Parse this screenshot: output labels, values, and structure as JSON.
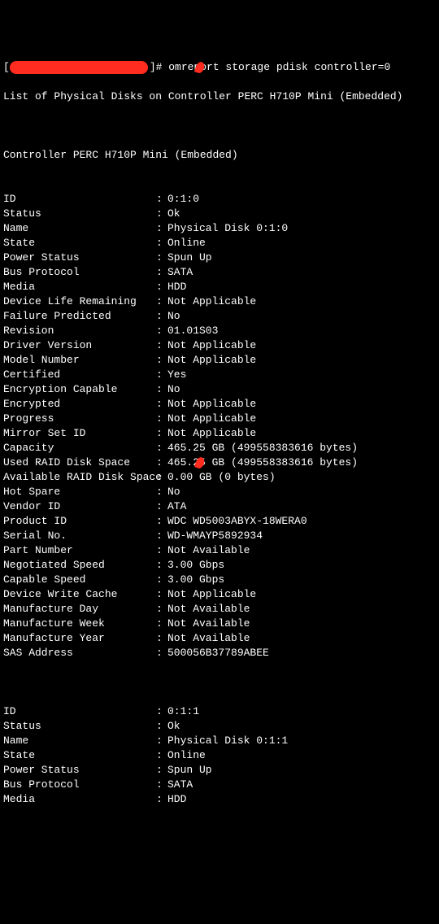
{
  "prompt": {
    "open": "[",
    "close": "]# ",
    "command": "omreport storage pdisk controller=0"
  },
  "header": "List of Physical Disks on Controller PERC H710P Mini (Embedded)",
  "controller": "Controller PERC H710P Mini (Embedded)",
  "separator": ":",
  "disk0": {
    "ID": "0:1:0",
    "Status": "Ok",
    "Name": "Physical Disk 0:1:0",
    "State": "Online",
    "Power Status": "Spun Up",
    "Bus Protocol": "SATA",
    "Media": "HDD",
    "Device Life Remaining": "Not Applicable",
    "Failure Predicted": "No",
    "Revision": "01.01S03",
    "Driver Version": "Not Applicable",
    "Model Number": "Not Applicable",
    "Certified": "Yes",
    "Encryption Capable": "No",
    "Encrypted": "Not Applicable",
    "Progress": "Not Applicable",
    "Mirror Set ID": "Not Applicable",
    "Capacity": "465.25 GB (499558383616 bytes)",
    "Used RAID Disk Space": "465.25 GB (499558383616 bytes)",
    "Available RAID Disk Space": "0.00 GB (0 bytes)",
    "Hot Spare": "No",
    "Vendor ID": "ATA",
    "Product ID": "WDC WD5003ABYX-18WERA0",
    "Serial No.": "WD-WMAYP5892934",
    "Part Number": "Not Available",
    "Negotiated Speed": "3.00 Gbps",
    "Capable Speed": "3.00 Gbps",
    "Device Write Cache": "Not Applicable",
    "Manufacture Day": "Not Available",
    "Manufacture Week": "Not Available",
    "Manufacture Year": "Not Available",
    "SAS Address": "500056B37789ABEE"
  },
  "disk0_keys": [
    "ID",
    "Status",
    "Name",
    "State",
    "Power Status",
    "Bus Protocol",
    "Media",
    "Device Life Remaining",
    "Failure Predicted",
    "Revision",
    "Driver Version",
    "Model Number",
    "Certified",
    "Encryption Capable",
    "Encrypted",
    "Progress",
    "Mirror Set ID",
    "Capacity",
    "Used RAID Disk Space",
    "Available RAID Disk Space",
    "Hot Spare",
    "Vendor ID",
    "Product ID",
    "Serial No.",
    "Part Number",
    "Negotiated Speed",
    "Capable Speed",
    "Device Write Cache",
    "Manufacture Day",
    "Manufacture Week",
    "Manufacture Year",
    "SAS Address"
  ],
  "disk1": {
    "ID": "0:1:1",
    "Status": "Ok",
    "Name": "Physical Disk 0:1:1",
    "State": "Online",
    "Power Status": "Spun Up",
    "Bus Protocol": "SATA",
    "Media": "HDD"
  },
  "disk1_keys": [
    "ID",
    "Status",
    "Name",
    "State",
    "Power Status",
    "Bus Protocol",
    "Media"
  ]
}
